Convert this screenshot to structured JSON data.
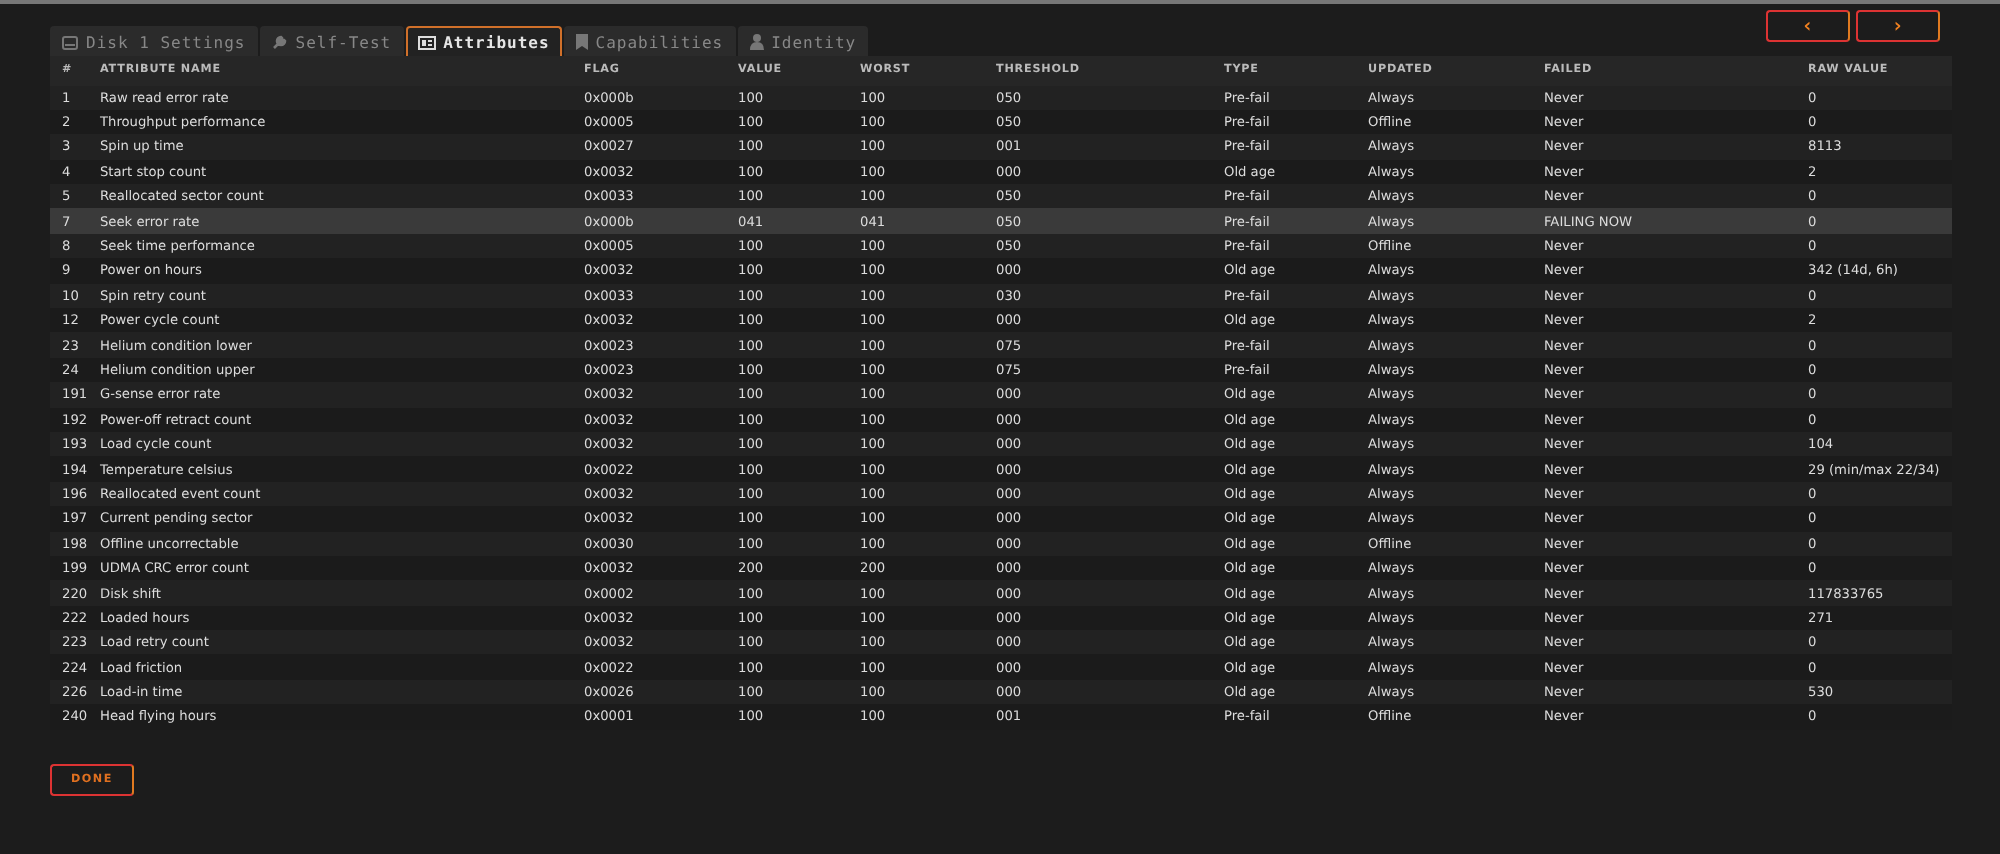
{
  "tabs": [
    {
      "label": "Disk 1 Settings",
      "selected": false
    },
    {
      "label": "Self-Test",
      "selected": false
    },
    {
      "label": "Attributes",
      "selected": true
    },
    {
      "label": "Capabilities",
      "selected": false
    },
    {
      "label": "Identity",
      "selected": false
    }
  ],
  "nav_buttons": [
    "‹",
    "›"
  ],
  "table": {
    "columns": [
      "#",
      "ATTRIBUTE NAME",
      "FLAG",
      "VALUE",
      "WORST",
      "THRESHOLD",
      "TYPE",
      "UPDATED",
      "FAILED",
      "RAW VALUE"
    ],
    "rows": [
      {
        "cells": [
          "1",
          "Raw read error rate",
          "0x000b",
          "100",
          "100",
          "050",
          "Pre-fail",
          "Always",
          "Never",
          "0"
        ],
        "selected": false
      },
      {
        "cells": [
          "2",
          "Throughput performance",
          "0x0005",
          "100",
          "100",
          "050",
          "Pre-fail",
          "Offline",
          "Never",
          "0"
        ],
        "selected": false
      },
      {
        "cells": [
          "3",
          "Spin up time",
          "0x0027",
          "100",
          "100",
          "001",
          "Pre-fail",
          "Always",
          "Never",
          "8113"
        ],
        "selected": false
      },
      {
        "cells": [
          "4",
          "Start stop count",
          "0x0032",
          "100",
          "100",
          "000",
          "Old age",
          "Always",
          "Never",
          "2"
        ],
        "selected": false
      },
      {
        "cells": [
          "5",
          "Reallocated sector count",
          "0x0033",
          "100",
          "100",
          "050",
          "Pre-fail",
          "Always",
          "Never",
          "0"
        ],
        "selected": false
      },
      {
        "cells": [
          "7",
          "Seek error rate",
          "0x000b",
          "041",
          "041",
          "050",
          "Pre-fail",
          "Always",
          "FAILING NOW",
          "0"
        ],
        "selected": true
      },
      {
        "cells": [
          "8",
          "Seek time performance",
          "0x0005",
          "100",
          "100",
          "050",
          "Pre-fail",
          "Offline",
          "Never",
          "0"
        ],
        "selected": false
      },
      {
        "cells": [
          "9",
          "Power on hours",
          "0x0032",
          "100",
          "100",
          "000",
          "Old age",
          "Always",
          "Never",
          "342 (14d, 6h)"
        ],
        "selected": false
      },
      {
        "cells": [
          "10",
          "Spin retry count",
          "0x0033",
          "100",
          "100",
          "030",
          "Pre-fail",
          "Always",
          "Never",
          "0"
        ],
        "selected": false
      },
      {
        "cells": [
          "12",
          "Power cycle count",
          "0x0032",
          "100",
          "100",
          "000",
          "Old age",
          "Always",
          "Never",
          "2"
        ],
        "selected": false
      },
      {
        "cells": [
          "23",
          "Helium condition lower",
          "0x0023",
          "100",
          "100",
          "075",
          "Pre-fail",
          "Always",
          "Never",
          "0"
        ],
        "selected": false
      },
      {
        "cells": [
          "24",
          "Helium condition upper",
          "0x0023",
          "100",
          "100",
          "075",
          "Pre-fail",
          "Always",
          "Never",
          "0"
        ],
        "selected": false
      },
      {
        "cells": [
          "191",
          "G-sense error rate",
          "0x0032",
          "100",
          "100",
          "000",
          "Old age",
          "Always",
          "Never",
          "0"
        ],
        "selected": false
      },
      {
        "cells": [
          "192",
          "Power-off retract count",
          "0x0032",
          "100",
          "100",
          "000",
          "Old age",
          "Always",
          "Never",
          "0"
        ],
        "selected": false
      },
      {
        "cells": [
          "193",
          "Load cycle count",
          "0x0032",
          "100",
          "100",
          "000",
          "Old age",
          "Always",
          "Never",
          "104"
        ],
        "selected": false
      },
      {
        "cells": [
          "194",
          "Temperature celsius",
          "0x0022",
          "100",
          "100",
          "000",
          "Old age",
          "Always",
          "Never",
          "29 (min/max 22/34)"
        ],
        "selected": false
      },
      {
        "cells": [
          "196",
          "Reallocated event count",
          "0x0032",
          "100",
          "100",
          "000",
          "Old age",
          "Always",
          "Never",
          "0"
        ],
        "selected": false
      },
      {
        "cells": [
          "197",
          "Current pending sector",
          "0x0032",
          "100",
          "100",
          "000",
          "Old age",
          "Always",
          "Never",
          "0"
        ],
        "selected": false
      },
      {
        "cells": [
          "198",
          "Offline uncorrectable",
          "0x0030",
          "100",
          "100",
          "000",
          "Old age",
          "Offline",
          "Never",
          "0"
        ],
        "selected": false
      },
      {
        "cells": [
          "199",
          "UDMA CRC error count",
          "0x0032",
          "200",
          "200",
          "000",
          "Old age",
          "Always",
          "Never",
          "0"
        ],
        "selected": false
      },
      {
        "cells": [
          "220",
          "Disk shift",
          "0x0002",
          "100",
          "100",
          "000",
          "Old age",
          "Always",
          "Never",
          "117833765"
        ],
        "selected": false
      },
      {
        "cells": [
          "222",
          "Loaded hours",
          "0x0032",
          "100",
          "100",
          "000",
          "Old age",
          "Always",
          "Never",
          "271"
        ],
        "selected": false
      },
      {
        "cells": [
          "223",
          "Load retry count",
          "0x0032",
          "100",
          "100",
          "000",
          "Old age",
          "Always",
          "Never",
          "0"
        ],
        "selected": false
      },
      {
        "cells": [
          "224",
          "Load friction",
          "0x0022",
          "100",
          "100",
          "000",
          "Old age",
          "Always",
          "Never",
          "0"
        ],
        "selected": false
      },
      {
        "cells": [
          "226",
          "Load-in time",
          "0x0026",
          "100",
          "100",
          "000",
          "Old age",
          "Always",
          "Never",
          "530"
        ],
        "selected": false
      },
      {
        "cells": [
          "240",
          "Head flying hours",
          "0x0001",
          "100",
          "100",
          "001",
          "Pre-fail",
          "Offline",
          "Never",
          "0"
        ],
        "selected": false
      }
    ]
  },
  "done_button": "DONE"
}
